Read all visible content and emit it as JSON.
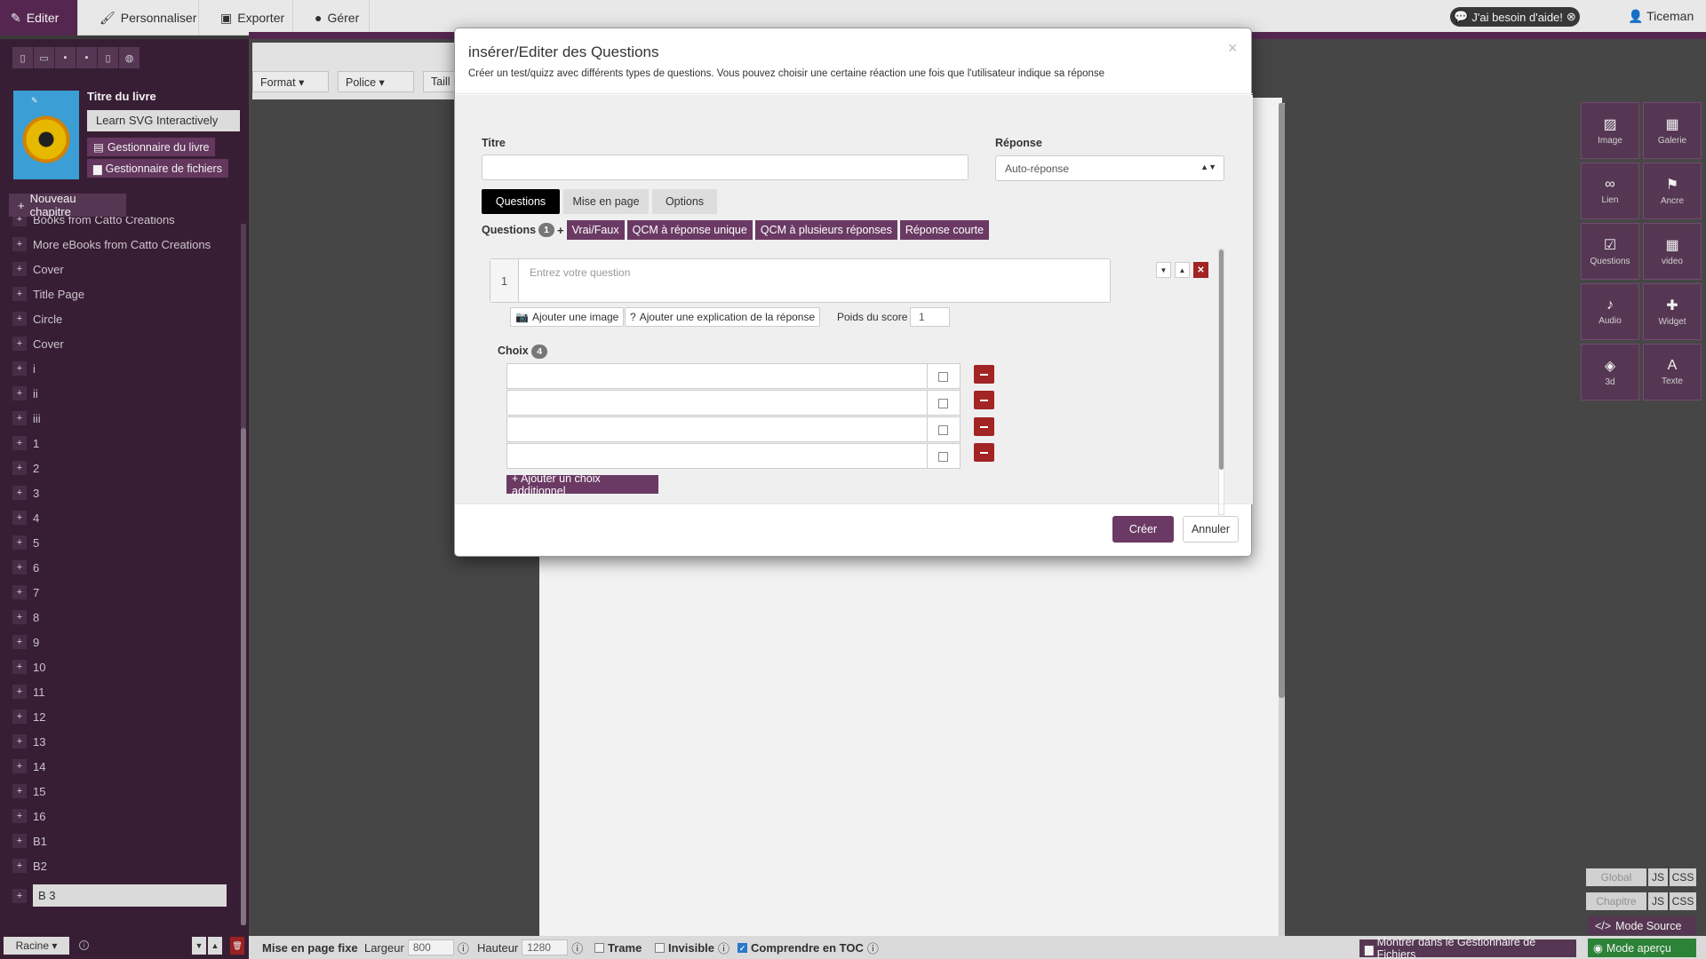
{
  "topbar": {
    "tabs": [
      {
        "label": "Editer",
        "icon": "pencil-icon"
      },
      {
        "label": "Personnaliser",
        "icon": "brush-icon"
      },
      {
        "label": "Exporter",
        "icon": "export-icon"
      },
      {
        "label": "Gérer",
        "icon": "user-icon"
      }
    ],
    "help_label": "J'ai besoin d'aide!",
    "user": "Ticeman"
  },
  "sidebar": {
    "book_title_label": "Titre du livre",
    "book_name": "Learn SVG Interactively",
    "book_manager": "Gestionnaire du livre",
    "file_manager": "Gestionnaire de fichiers",
    "new_chapter": "Nouveau chapitre",
    "chapters": [
      "Books from Catto Creations",
      "More eBooks from Catto Creations",
      "Cover",
      "Title Page",
      "Circle",
      "Cover",
      "i",
      "ii",
      "iii",
      "1",
      "2",
      "3",
      "4",
      "5",
      "6",
      "7",
      "8",
      "9",
      "10",
      "11",
      "12",
      "13",
      "14",
      "15",
      "16",
      "B1",
      "B2",
      "B 3"
    ],
    "root_label": "Racine"
  },
  "editor": {
    "format_label": "Format",
    "font_label": "Police",
    "size_label": "Taill"
  },
  "widgets": [
    {
      "label": "Image",
      "icon": "image-icon"
    },
    {
      "label": "Galerie",
      "icon": "gallery-icon"
    },
    {
      "label": "Lien",
      "icon": "link-icon"
    },
    {
      "label": "Ancre",
      "icon": "flag-icon"
    },
    {
      "label": "Questions",
      "icon": "checkbox-icon"
    },
    {
      "label": "video",
      "icon": "film-icon"
    },
    {
      "label": "Audio",
      "icon": "microphone-icon"
    },
    {
      "label": "Widget",
      "icon": "puzzle-icon"
    },
    {
      "label": "3d",
      "icon": "cube-icon"
    },
    {
      "label": "Texte",
      "icon": "text-icon"
    }
  ],
  "right_panel": {
    "global": "Global",
    "chapitre": "Chapitre",
    "js": "JS",
    "css": "CSS",
    "mode_source": "Mode Source",
    "mode_apercu": "Mode aperçu"
  },
  "bottombar": {
    "fixed_layout": "Mise en page fixe",
    "width_label": "Largeur",
    "width_value": "800",
    "height_label": "Hauteur",
    "height_value": "1280",
    "grid": "Trame",
    "invisible": "Invisible",
    "toc": "Comprendre en TOC",
    "show_in_fm": "Montrer dans le Gestionnaire de Fichiers"
  },
  "modal": {
    "title": "insérer/Editer des Questions",
    "subtitle": "Créer un test/quizz avec différents types de questions. Vous pouvez choisir une certaine réaction une fois que l'utilisateur indique sa réponse",
    "titre_label": "Titre",
    "reponse_label": "Réponse",
    "reponse_value": "Auto-réponse",
    "tabs": [
      "Questions",
      "Mise en page",
      "Options"
    ],
    "questions_label": "Questions",
    "questions_count": "1",
    "plus": "+",
    "qtypes": [
      "Vrai/Faux",
      "QCM à réponse unique",
      "QCM à plusieurs réponses",
      "Réponse courte"
    ],
    "question_number": "1",
    "question_placeholder": "Entrez votre question",
    "add_image": "Ajouter une image",
    "add_explanation": "Ajouter une explication de la réponse",
    "score_label": "Poids du score",
    "score_value": "1",
    "choices_label": "Choix",
    "choices_count": "4",
    "add_choice": "+ Ajouter un choix additionnel",
    "create": "Créer",
    "cancel": "Annuler",
    "close": "×"
  },
  "colors": {
    "brand_purple": "#5b3a58",
    "danger_red": "#a32424",
    "success_green": "#2f8a3a"
  }
}
